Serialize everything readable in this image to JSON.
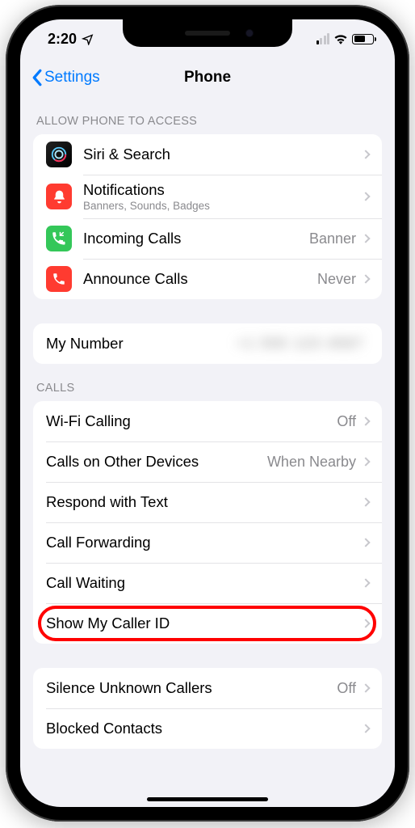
{
  "status": {
    "time": "2:20"
  },
  "nav": {
    "back": "Settings",
    "title": "Phone"
  },
  "sections": {
    "access_header": "ALLOW PHONE TO ACCESS",
    "calls_header": "CALLS"
  },
  "access": {
    "siri": "Siri & Search",
    "notifications": {
      "title": "Notifications",
      "sub": "Banners, Sounds, Badges"
    },
    "incoming": {
      "title": "Incoming Calls",
      "value": "Banner"
    },
    "announce": {
      "title": "Announce Calls",
      "value": "Never"
    }
  },
  "number": {
    "label": "My Number",
    "value": "+1 555 123 4567"
  },
  "calls": {
    "wifi": {
      "title": "Wi-Fi Calling",
      "value": "Off"
    },
    "other_devices": {
      "title": "Calls on Other Devices",
      "value": "When Nearby"
    },
    "respond": "Respond with Text",
    "forwarding": "Call Forwarding",
    "waiting": "Call Waiting",
    "caller_id": "Show My Caller ID"
  },
  "more": {
    "silence": {
      "title": "Silence Unknown Callers",
      "value": "Off"
    },
    "blocked": "Blocked Contacts"
  }
}
